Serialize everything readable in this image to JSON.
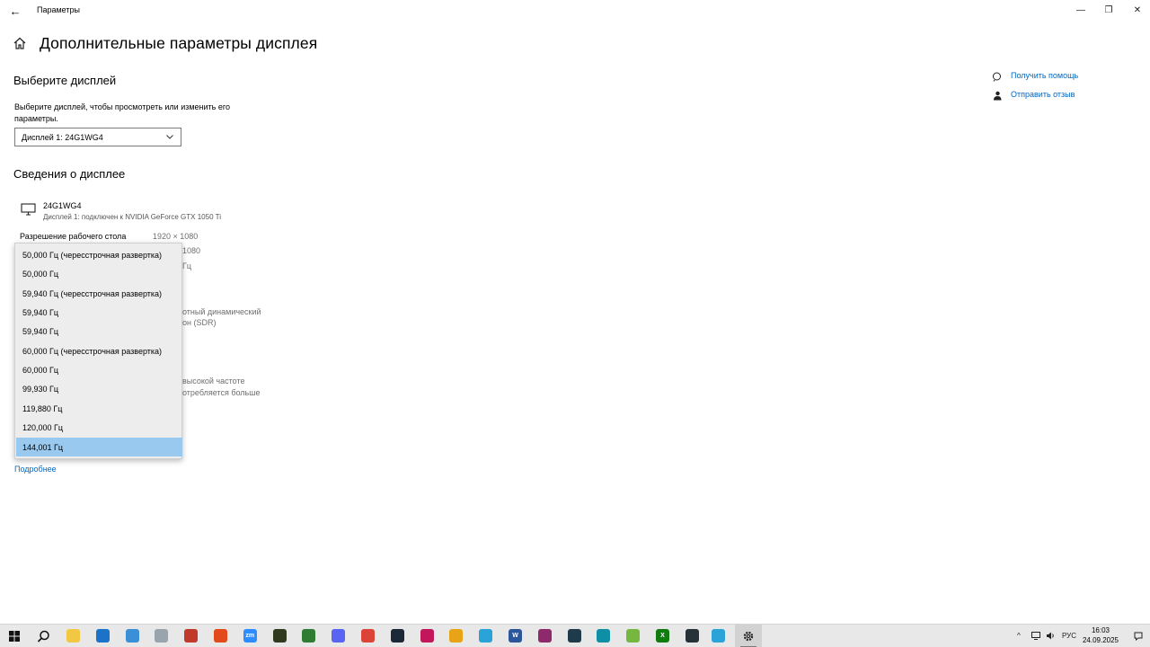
{
  "window": {
    "title": "Параметры",
    "back_glyph": "←",
    "minimize_glyph": "—",
    "maximize_glyph": "❐",
    "close_glyph": "✕"
  },
  "page": {
    "title": "Дополнительные параметры дисплея"
  },
  "choose_display": {
    "heading": "Выберите дисплей",
    "description": "Выберите дисплей, чтобы просмотреть или изменить его параметры.",
    "selected_display": "Дисплей 1: 24G1WG4"
  },
  "display_info": {
    "heading": "Сведения о дисплее",
    "monitor_name": "24G1WG4",
    "monitor_connection": "Дисплей 1: подключен к NVIDIA GeForce GTX 1050 Ti",
    "resolution_label": "Разрешение рабочего стола",
    "resolution_value": "1920 × 1080",
    "obscured_fragments": [
      "1080",
      "Гц",
      "отный динамический",
      "он (SDR)",
      "высокой частоте",
      "отребляется больше"
    ]
  },
  "more_link": "Подробнее",
  "help": {
    "get_help": "Получить помощь",
    "send_feedback": "Отправить отзыв"
  },
  "refresh_rate_dropdown": {
    "options": [
      "50,000 Гц (чересстрочная развертка)",
      "50,000 Гц",
      "59,940 Гц (чересстрочная развертка)",
      "59,940 Гц",
      "59,940 Гц",
      "60,000 Гц (чересстрочная развертка)",
      "60,000 Гц",
      "99,930 Гц",
      "119,880 Гц",
      "120,000 Гц",
      "144,001 Гц"
    ],
    "selected": "144,001 Гц"
  },
  "taskbar": {
    "apps": [
      {
        "name": "file-explorer",
        "color": "#f2c744",
        "glyph": ""
      },
      {
        "name": "store",
        "color": "#1a73c9",
        "glyph": ""
      },
      {
        "name": "app-blue-1",
        "color": "#3b8fd6",
        "glyph": ""
      },
      {
        "name": "app-gray",
        "color": "#9aa4ad",
        "glyph": ""
      },
      {
        "name": "app-red",
        "color": "#c0392b",
        "glyph": ""
      },
      {
        "name": "app-flame",
        "color": "#e24a1c",
        "glyph": ""
      },
      {
        "name": "zoom",
        "color": "#2d8cff",
        "glyph": "zm"
      },
      {
        "name": "nvidia",
        "color": "#2f3a1e",
        "glyph": ""
      },
      {
        "name": "app-green",
        "color": "#2e7d32",
        "glyph": ""
      },
      {
        "name": "discord",
        "color": "#5865f2",
        "glyph": ""
      },
      {
        "name": "chrome-profile",
        "color": "#db4437",
        "glyph": ""
      },
      {
        "name": "steam",
        "color": "#1b2838",
        "glyph": ""
      },
      {
        "name": "app-pink",
        "color": "#c2185b",
        "glyph": ""
      },
      {
        "name": "chrome",
        "color": "#e8a317",
        "glyph": ""
      },
      {
        "name": "telegram",
        "color": "#2aa3d8",
        "glyph": ""
      },
      {
        "name": "word",
        "color": "#2b579a",
        "glyph": "W"
      },
      {
        "name": "winrar",
        "color": "#8e2a6b",
        "glyph": ""
      },
      {
        "name": "terminal",
        "color": "#1f3a4a",
        "glyph": ""
      },
      {
        "name": "edge",
        "color": "#0f8fa6",
        "glyph": ""
      },
      {
        "name": "utorrent",
        "color": "#76b83f",
        "glyph": ""
      },
      {
        "name": "xbox",
        "color": "#107c10",
        "glyph": "X"
      },
      {
        "name": "app-dark",
        "color": "#263238",
        "glyph": ""
      },
      {
        "name": "telegram-2",
        "color": "#2aa3d8",
        "glyph": ""
      }
    ],
    "tray_language": "РУС",
    "time": "16:03",
    "date": "24.09.2025"
  }
}
